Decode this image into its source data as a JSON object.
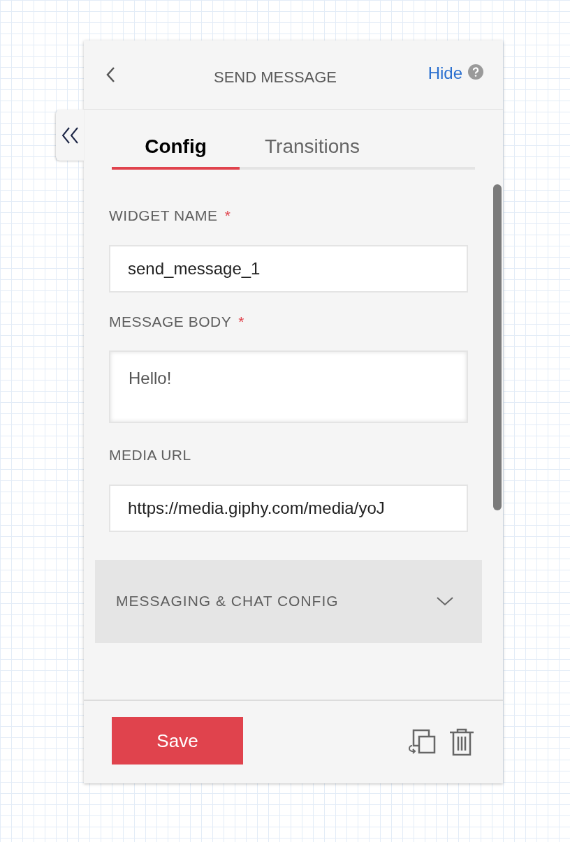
{
  "panel": {
    "title": "SEND MESSAGE",
    "hide_link": "Hide"
  },
  "tabs": [
    {
      "label": "Config",
      "selected": true
    },
    {
      "label": "Transitions",
      "selected": false
    }
  ],
  "fields": [
    {
      "label": "WIDGET NAME",
      "required_mark": "*",
      "kind": "input",
      "value": "send_message_1"
    },
    {
      "label": "MESSAGE BODY",
      "required_mark": "*",
      "kind": "textarea",
      "value": "Hello!"
    },
    {
      "label": "MEDIA URL",
      "kind": "input",
      "value": "https://media.giphy.com/media/yoJ"
    }
  ],
  "accordion": {
    "title": "MESSAGING & CHAT CONFIG",
    "expanded": false
  },
  "footer": {
    "save_button": "Save"
  }
}
